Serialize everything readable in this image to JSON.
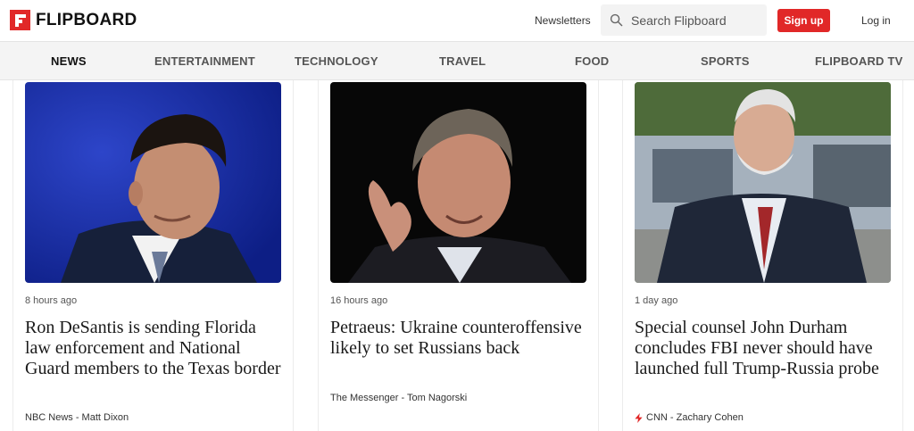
{
  "header": {
    "logo_text": "FLIPBOARD",
    "newsletters": "Newsletters",
    "search_placeholder": "Search Flipboard",
    "signup": "Sign up",
    "login": "Log in"
  },
  "colors": {
    "brand_red": "#e12828"
  },
  "nav": {
    "items": [
      {
        "label": "NEWS",
        "active": true
      },
      {
        "label": "ENTERTAINMENT"
      },
      {
        "label": "TECHNOLOGY"
      },
      {
        "label": "TRAVEL"
      },
      {
        "label": "FOOD"
      },
      {
        "label": "SPORTS"
      },
      {
        "label": "FLIPBOARD TV"
      }
    ]
  },
  "cards": [
    {
      "time": "8 hours ago",
      "title": "Ron DeSantis is sending Florida law enforcement and National Guard members to the Texas border",
      "source": "NBC News - Matt Dixon",
      "source_icon": ""
    },
    {
      "time": "16 hours ago",
      "title": "Petraeus: Ukraine counteroffensive likely to set Russians back",
      "source": "The Messenger - Tom Nagorski",
      "source_icon": ""
    },
    {
      "time": "1 day ago",
      "title": "Special counsel John Durham concludes FBI never should have launched full Trump-Russia probe",
      "source": "CNN - Zachary Cohen",
      "source_icon": "bolt-icon"
    }
  ]
}
